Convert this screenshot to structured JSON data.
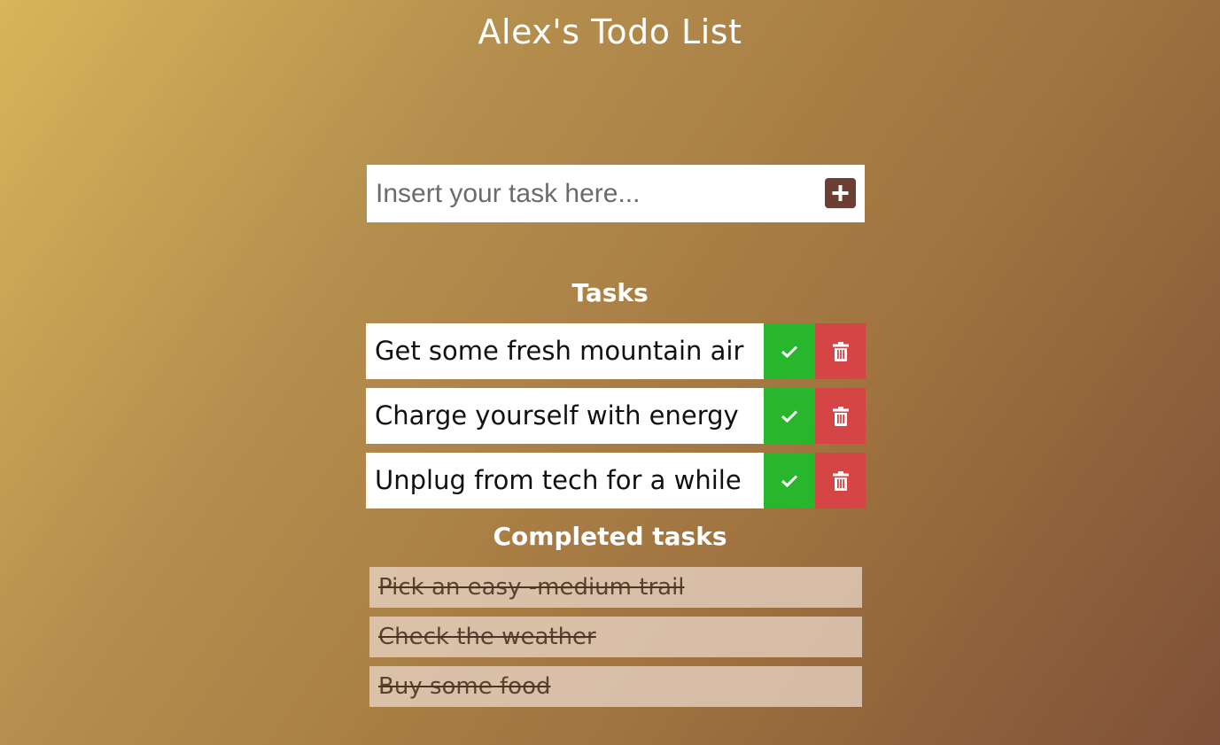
{
  "header": {
    "title": "Alex's Todo List"
  },
  "add_form": {
    "placeholder": "Insert your task here...",
    "value": "",
    "add_icon": "plus-icon"
  },
  "tasks": {
    "heading": "Tasks",
    "items": [
      {
        "text": "Get some fresh mountain air",
        "complete_icon": "check-icon",
        "delete_icon": "trash-icon"
      },
      {
        "text": "Charge yourself with energy",
        "complete_icon": "check-icon",
        "delete_icon": "trash-icon"
      },
      {
        "text": "Unplug from tech for a while",
        "complete_icon": "check-icon",
        "delete_icon": "trash-icon"
      }
    ]
  },
  "completed": {
    "heading": "Completed tasks",
    "items": [
      {
        "text": "Pick an easy -medium trail"
      },
      {
        "text": "Check the weather"
      },
      {
        "text": "Buy some food"
      }
    ]
  },
  "colors": {
    "complete_button": "#27b62c",
    "delete_button": "#d64545",
    "add_button": "#6b3f33",
    "background_start": "#d8b55a",
    "background_end": "#7f5038"
  }
}
